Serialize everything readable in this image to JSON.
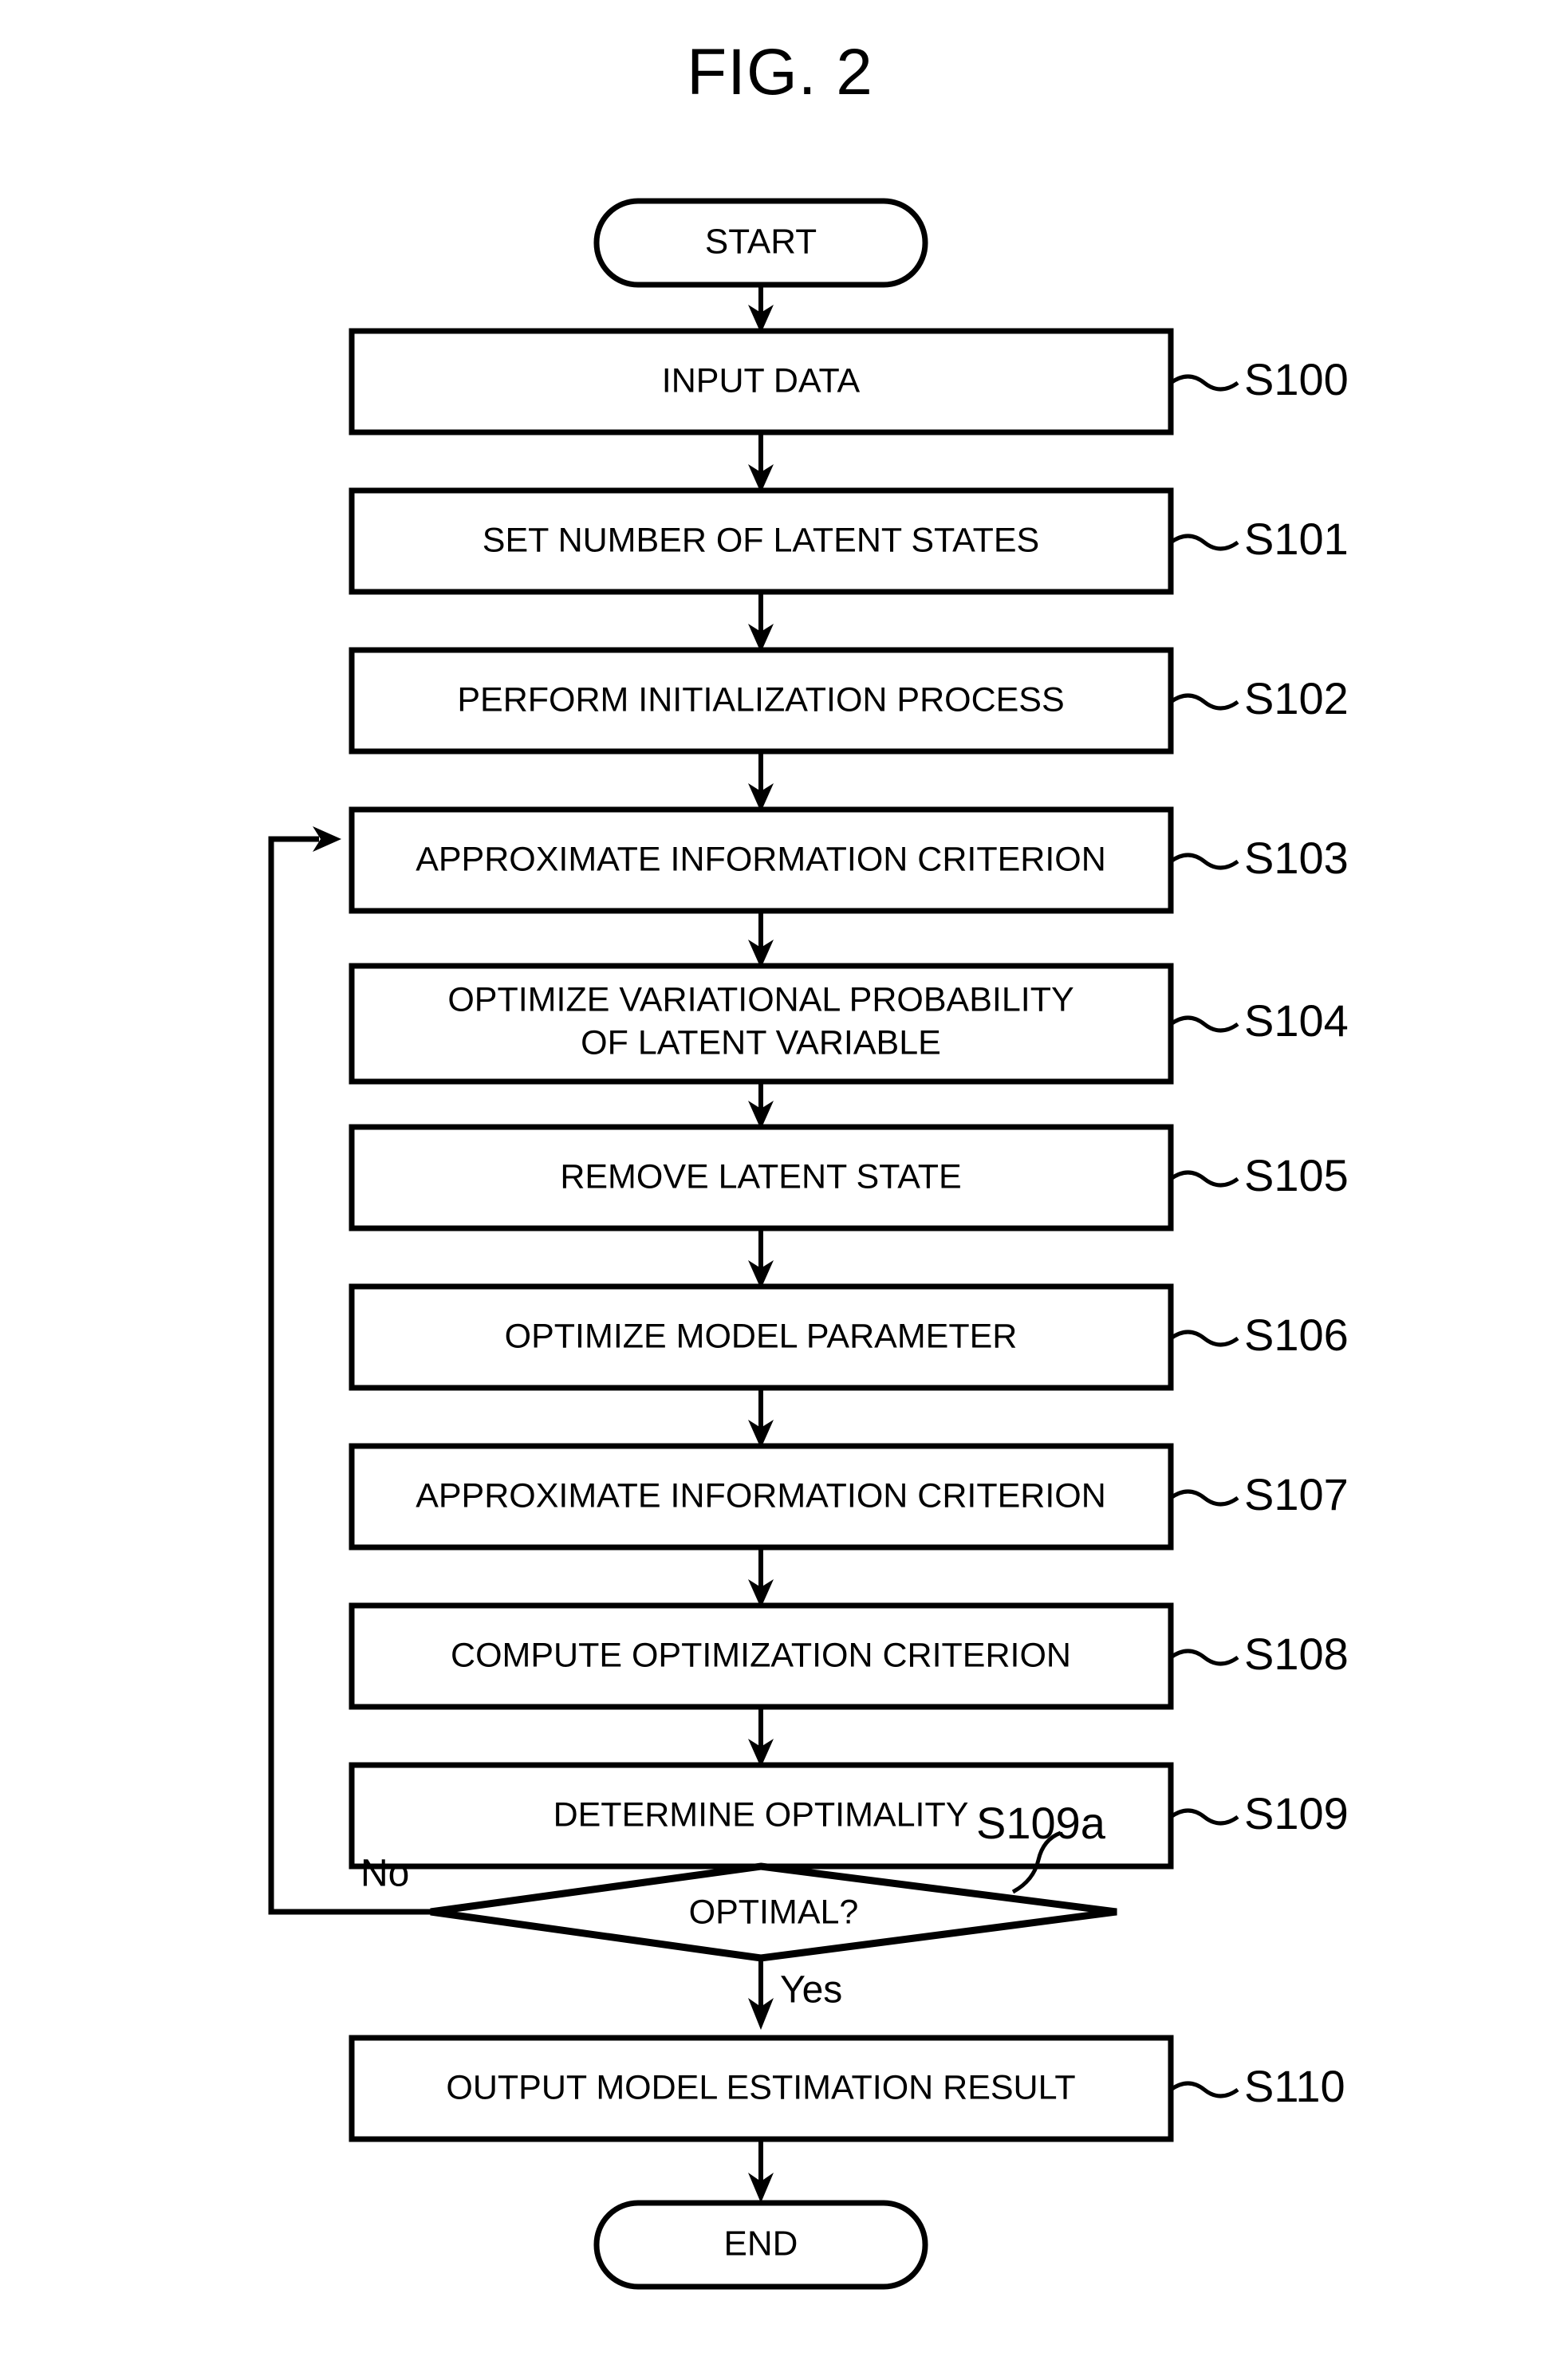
{
  "figure": {
    "title": "FIG. 2"
  },
  "flowchart": {
    "type": "flowchart",
    "orientation": "top-to-bottom",
    "terminals": {
      "start": "START",
      "end": "END"
    },
    "nodes": [
      {
        "id": "start",
        "shape": "stadium",
        "text": "START",
        "step": ""
      },
      {
        "id": "s100",
        "shape": "process",
        "text": "INPUT DATA",
        "step": "S100"
      },
      {
        "id": "s101",
        "shape": "process",
        "text": "SET NUMBER OF LATENT STATES",
        "step": "S101"
      },
      {
        "id": "s102",
        "shape": "process",
        "text": "PERFORM INITIALIZATION PROCESS",
        "step": "S102"
      },
      {
        "id": "s103",
        "shape": "process",
        "text": "APPROXIMATE INFORMATION CRITERION",
        "step": "S103"
      },
      {
        "id": "s104",
        "shape": "process",
        "text": "OPTIMIZE VARIATIONAL PROBABILITY OF LATENT VARIABLE",
        "step": "S104",
        "line1": "OPTIMIZE VARIATIONAL PROBABILITY",
        "line2": "OF LATENT VARIABLE"
      },
      {
        "id": "s105",
        "shape": "process",
        "text": "REMOVE LATENT STATE",
        "step": "S105"
      },
      {
        "id": "s106",
        "shape": "process",
        "text": "OPTIMIZE MODEL PARAMETER",
        "step": "S106"
      },
      {
        "id": "s107",
        "shape": "process",
        "text": "APPROXIMATE INFORMATION CRITERION",
        "step": "S107"
      },
      {
        "id": "s108",
        "shape": "process",
        "text": "COMPUTE OPTIMIZATION CRITERION",
        "step": "S108"
      },
      {
        "id": "s109",
        "shape": "process",
        "text": "DETERMINE OPTIMALITY",
        "step": "S109"
      },
      {
        "id": "s109a",
        "shape": "decision",
        "text": "OPTIMAL?",
        "step": "S109a"
      },
      {
        "id": "s110",
        "shape": "process",
        "text": "OUTPUT MODEL ESTIMATION RESULT",
        "step": "S110"
      },
      {
        "id": "end",
        "shape": "stadium",
        "text": "END",
        "step": ""
      }
    ],
    "branches": {
      "no": "No",
      "yes": "Yes"
    },
    "edges": [
      {
        "from": "start",
        "to": "s100",
        "label": ""
      },
      {
        "from": "s100",
        "to": "s101",
        "label": ""
      },
      {
        "from": "s101",
        "to": "s102",
        "label": ""
      },
      {
        "from": "s102",
        "to": "s103",
        "label": ""
      },
      {
        "from": "s103",
        "to": "s104",
        "label": ""
      },
      {
        "from": "s104",
        "to": "s105",
        "label": ""
      },
      {
        "from": "s105",
        "to": "s106",
        "label": ""
      },
      {
        "from": "s106",
        "to": "s107",
        "label": ""
      },
      {
        "from": "s107",
        "to": "s108",
        "label": ""
      },
      {
        "from": "s108",
        "to": "s109",
        "label": ""
      },
      {
        "from": "s109",
        "to": "s109a",
        "label": ""
      },
      {
        "from": "s109a",
        "to": "s103",
        "label": "No"
      },
      {
        "from": "s109a",
        "to": "s110",
        "label": "Yes"
      },
      {
        "from": "s110",
        "to": "end",
        "label": ""
      }
    ],
    "colors": {
      "stroke": "#000000",
      "fill": "#ffffff",
      "text": "#000000"
    }
  }
}
